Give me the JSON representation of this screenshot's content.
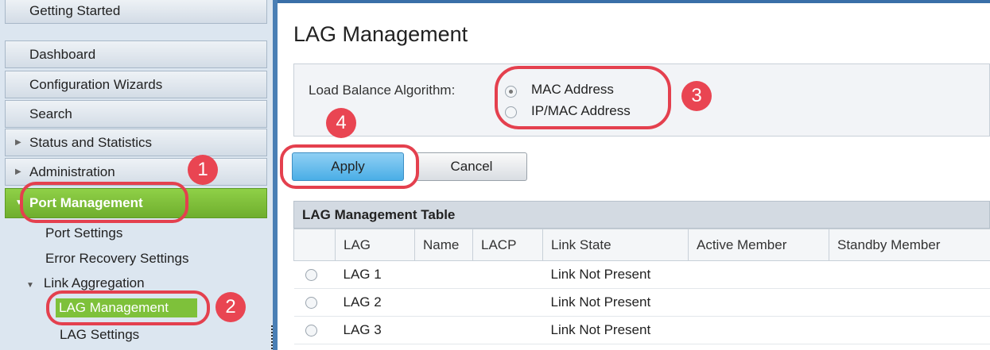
{
  "sidebar": {
    "menu": [
      {
        "label": "Getting Started"
      },
      {
        "label": "Dashboard"
      },
      {
        "label": "Configuration Wizards"
      },
      {
        "label": "Search"
      },
      {
        "label": "Status and Statistics"
      },
      {
        "label": "Administration"
      },
      {
        "label": "Port Management"
      }
    ],
    "sub": {
      "port_settings": "Port Settings",
      "error_recovery": "Error Recovery Settings",
      "link_aggregation": "Link Aggregation",
      "lag_management": "LAG Management",
      "lag_settings": "LAG Settings"
    }
  },
  "main": {
    "title": "LAG Management",
    "load_balance": {
      "label": "Load Balance Algorithm:",
      "options": [
        "MAC Address",
        "IP/MAC Address"
      ],
      "selected": "MAC Address"
    },
    "buttons": {
      "apply": "Apply",
      "cancel": "Cancel"
    },
    "table": {
      "title": "LAG Management Table",
      "columns": [
        "",
        "LAG",
        "Name",
        "LACP",
        "Link State",
        "Active Member",
        "Standby Member"
      ],
      "rows": [
        {
          "lag": "LAG 1",
          "name": "",
          "lacp": "",
          "link_state": "Link Not Present"
        },
        {
          "lag": "LAG 2",
          "name": "",
          "lacp": "",
          "link_state": "Link Not Present"
        },
        {
          "lag": "LAG 3",
          "name": "",
          "lacp": "",
          "link_state": "Link Not Present"
        }
      ]
    }
  },
  "annotations": {
    "step1": "1",
    "step2": "2",
    "step3": "3",
    "step4": "4"
  },
  "colors": {
    "accent_green": "#7ec13a",
    "annotation_red": "#e4404e",
    "apply_blue": "#4aaee6"
  }
}
